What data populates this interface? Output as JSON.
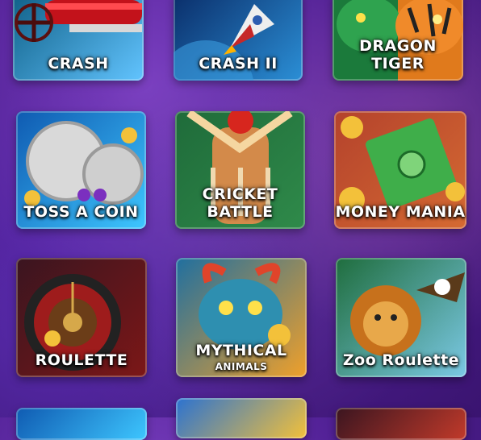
{
  "games": [
    {
      "key": "crash",
      "label": "CRASH",
      "colors": [
        "#0f5f86",
        "#62c4ff"
      ]
    },
    {
      "key": "crash2",
      "label": "CRASH II",
      "colors": [
        "#0a2d69",
        "#2b8fd6"
      ]
    },
    {
      "key": "dragon_tiger",
      "label": "DRAGON TIGER",
      "colors": [
        "#1b7a3b",
        "#e07a1c"
      ]
    },
    {
      "key": "toss_coin",
      "label": "TOSS A COIN",
      "colors": [
        "#0f5ab1",
        "#3ec7ff"
      ]
    },
    {
      "key": "cricket",
      "label": "CRICKET BATTLE",
      "colors": [
        "#1f6b3a",
        "#d38a4a"
      ]
    },
    {
      "key": "money",
      "label": "MONEY MANIA",
      "colors": [
        "#b4422c",
        "#3fae4a"
      ]
    },
    {
      "key": "roulette",
      "label": "ROULETTE",
      "colors": [
        "#222",
        "#7c1717"
      ]
    },
    {
      "key": "mythical",
      "label": "MYTHICAL",
      "sublabel": "ANIMALS",
      "colors": [
        "#1f6fa0",
        "#f0a02a"
      ]
    },
    {
      "key": "zoo",
      "label": "Zoo Roulette",
      "colors": [
        "#1f6d3d",
        "#7bc9e5"
      ]
    }
  ]
}
